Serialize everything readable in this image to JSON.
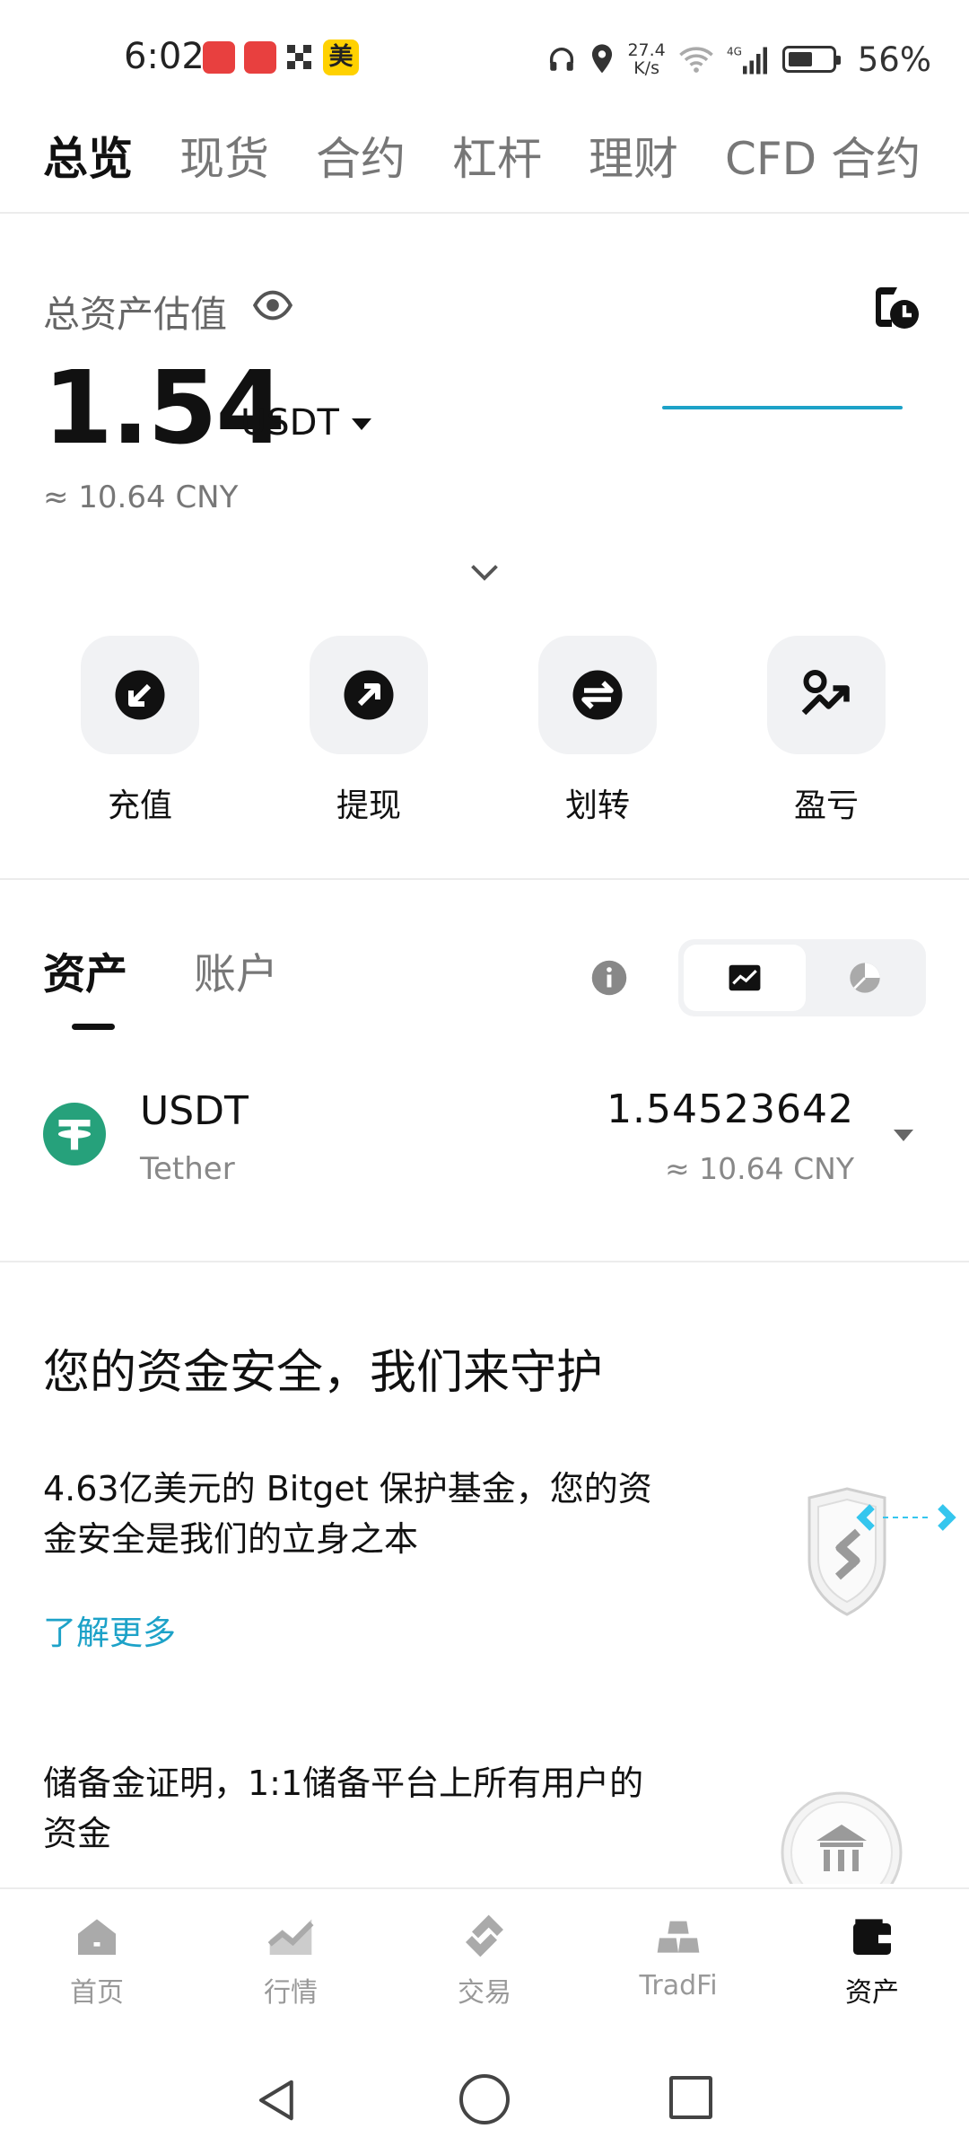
{
  "status_bar": {
    "time": "6:02",
    "network_speed_value": "27.4",
    "network_speed_unit": "K/s",
    "signal_type": "4G",
    "battery_percent": "56%",
    "app_icons": [
      "huawei-store-icon",
      "huawei-store-icon",
      "grid-app-icon",
      "meituan-icon"
    ],
    "meituan_label": "美"
  },
  "top_tabs": [
    {
      "label": "总览",
      "active": true
    },
    {
      "label": "现货",
      "active": false
    },
    {
      "label": "合约",
      "active": false
    },
    {
      "label": "杠杆",
      "active": false
    },
    {
      "label": "理财",
      "active": false
    },
    {
      "label": "CFD 合约",
      "active": false
    }
  ],
  "summary": {
    "label": "总资产估值",
    "value": "1.54",
    "unit": "USDT",
    "approx_cny": "≈ 10.64 CNY",
    "accent_color": "#1da2c8"
  },
  "actions": [
    {
      "label": "充值",
      "icon": "deposit-icon"
    },
    {
      "label": "提现",
      "icon": "withdraw-icon"
    },
    {
      "label": "划转",
      "icon": "transfer-icon"
    },
    {
      "label": "盈亏",
      "icon": "pnl-icon"
    }
  ],
  "asset_tabs": [
    {
      "label": "资产",
      "active": true
    },
    {
      "label": "账户",
      "active": false
    }
  ],
  "holdings": [
    {
      "symbol": "USDT",
      "name": "Tether",
      "amount": "1.54523642",
      "approx_cny": "≈ 10.64 CNY",
      "logo_color": "#26a17b"
    }
  ],
  "security": {
    "title": "您的资金安全，我们来守护",
    "fund_desc": "4.63亿美元的 Bitget 保护基金，您的资金安全是我们的立身之本",
    "learn_more": "了解更多",
    "reserve_desc": "储备金证明，1:1储备平台上所有用户的资金"
  },
  "bottom_nav": [
    {
      "label": "首页",
      "icon": "home-icon",
      "active": false
    },
    {
      "label": "行情",
      "icon": "market-icon",
      "active": false
    },
    {
      "label": "交易",
      "icon": "trade-icon",
      "active": false
    },
    {
      "label": "TradFi",
      "icon": "tradfi-icon",
      "active": false
    },
    {
      "label": "资产",
      "icon": "wallet-icon",
      "active": true
    }
  ]
}
